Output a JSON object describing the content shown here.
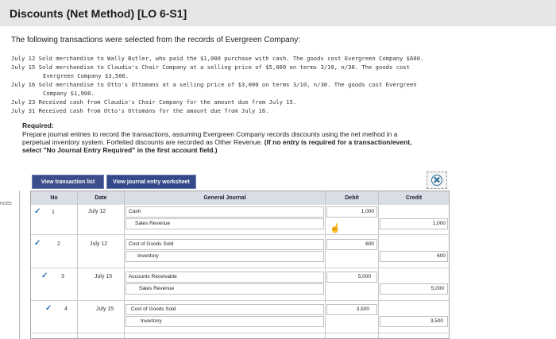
{
  "title": "Discounts (Net Method) [LO 6-S1]",
  "intro": "The following transactions were selected from the records of Evergreen Company:",
  "transactions": [
    {
      "line": "July 12 Sold merchandise to Wally Butler, who paid the $1,000 purchase with cash. The goods cost Evergreen Company $600."
    },
    {
      "line": "July 15 Sold merchandise to Claudio's Chair Company at a selling price of $5,000 on terms 3/10, n/30. The goods cost"
    },
    {
      "line": "Evergreen Company $3,500."
    },
    {
      "line": "July 16 Sold merchandise to Otto's Ottomans at a selling price of $3,000 on terms 3/10, n/30. The goods cost Evergreen"
    },
    {
      "line": "Company $1,900."
    },
    {
      "line": "July 23 Received cash from Claudio's Chair Company for the amount due from July 15."
    },
    {
      "line": "July 31 Received cash from Otto's Ottomans for the amount due from July 16."
    }
  ],
  "required_heading": "Required:",
  "required_line1": "Prepare journal entries to record the transactions, assuming Evergreen Company records discounts using the net method in a",
  "required_line2": "perpetual inventory system. Forfeited discounts are recorded as Other Revenue.",
  "required_bold1": "(If no entry is required for a transaction/event,",
  "required_bold2": "select \"No Journal Entry Required\" in the first account field.)",
  "tabs": {
    "transaction_list": "View transaction list",
    "journal_worksheet": "View journal entry worksheet"
  },
  "side_label": "nces",
  "table": {
    "headers": {
      "no": "No",
      "date": "Date",
      "general_journal": "General Journal",
      "debit": "Debit",
      "credit": "Credit"
    },
    "rows": [
      {
        "no": "1",
        "date": "July 12",
        "debit_account": "Cash",
        "credit_account": "Sales Revenue",
        "debit": "1,000",
        "credit": "1,000"
      },
      {
        "no": "2",
        "date": "July 12",
        "debit_account": "Cost of Goods Sold",
        "credit_account": "Inventory",
        "debit": "600",
        "credit": "600"
      },
      {
        "no": "3",
        "date": "July 15",
        "debit_account": "Accounts Receivable",
        "credit_account": "Sales Revenue",
        "debit": "5,000",
        "credit": "5,000"
      },
      {
        "no": "4",
        "date": "July 15",
        "debit_account": "Cost of Goods Sold",
        "credit_account": "Inventory",
        "debit": "3,500",
        "credit": "3,500"
      }
    ]
  },
  "colors": {
    "tab_bg": "#3b4d8a",
    "header_bg": "#d9dde5",
    "check": "#2e6fb5"
  }
}
